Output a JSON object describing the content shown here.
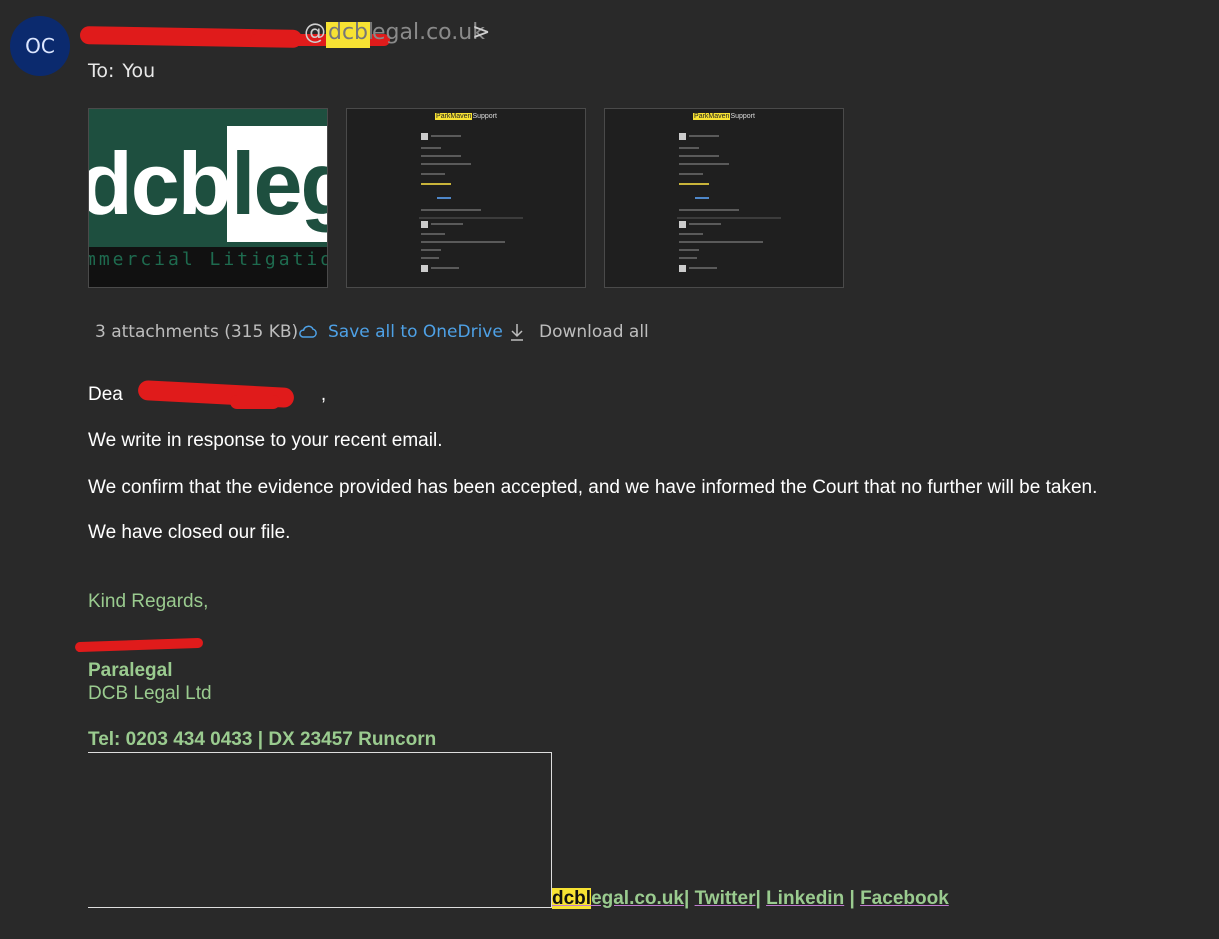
{
  "sender": {
    "avatar_initials": "OC",
    "address_at": "@",
    "address_domain_hl": "dcbl",
    "address_domain_rest": "egal.co.uk",
    "address_close": ">"
  },
  "recipient": {
    "label": "To:",
    "value": "You"
  },
  "attachments": {
    "thumb1_logo_left": "dcb",
    "thumb1_logo_right": "leg",
    "thumb1_subtitle": "mmercial Litigation",
    "thumb2_title_hl": "ParkMaven",
    "thumb2_title_rest": "Support",
    "thumb3_title_hl": "ParkMaven",
    "thumb3_title_rest": "Support",
    "count_label": "3 attachments (315 KB)",
    "save_label": "Save all to OneDrive",
    "download_label": "Download all"
  },
  "body": {
    "greeting_start": "Dea",
    "greeting_end": ",",
    "p1": "We write in response to your recent email.",
    "p2": "We confirm that the evidence provided has been accepted, and we have informed the Court that no further will be taken.",
    "p3": "We have closed our file."
  },
  "signature": {
    "closing": "Kind Regards,",
    "role": "Paralegal",
    "company": "DCB Legal Ltd",
    "contact": "Tel: 0203 434 0433 | DX 23457 Runcorn"
  },
  "links": {
    "site_hl": "dcbl",
    "site_rest": "egal.co.uk",
    "twitter": "Twitter",
    "linkedin": "Linkedin",
    "facebook": "Facebook"
  },
  "colors": {
    "background": "#292929",
    "accent_green": "#9acb8f",
    "link_blue": "#4ea1e6",
    "redaction": "#e01b1b",
    "highlight": "#f7e233"
  }
}
